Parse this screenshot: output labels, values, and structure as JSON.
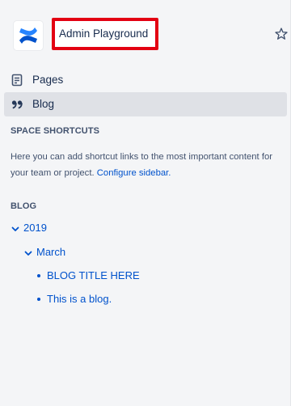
{
  "space": {
    "title": "Admin Playground",
    "logo_icon": "confluence-logo-icon",
    "star_icon": "star-icon"
  },
  "nav": [
    {
      "label": "Pages",
      "icon": "page-icon",
      "selected": false
    },
    {
      "label": "Blog",
      "icon": "quote-icon",
      "selected": true
    }
  ],
  "shortcuts": {
    "heading": "SPACE SHORTCUTS",
    "text": "Here you can add shortcut links to the most important content for your team or project.",
    "link": "Configure sidebar."
  },
  "blog": {
    "heading": "BLOG",
    "year": "2019",
    "month": "March",
    "posts": [
      "BLOG TITLE HERE",
      "This is a blog."
    ]
  },
  "colors": {
    "accent": "#0052cc",
    "highlight_border": "#e30012",
    "sidebar_bg": "#f4f5f7",
    "selected_bg": "#dfe1e6"
  }
}
